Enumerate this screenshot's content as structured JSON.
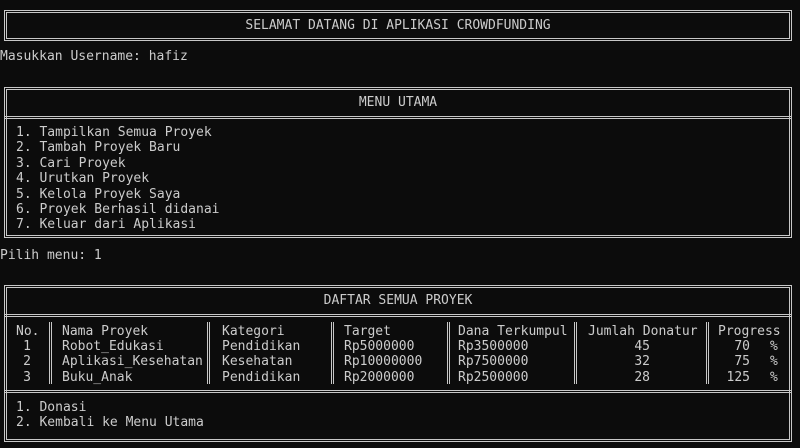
{
  "welcome_banner": "SELAMAT DATANG DI APLIKASI CROWDFUNDING",
  "username_prompt": "Masukkan Username: hafiz",
  "main_menu": {
    "title": "MENU UTAMA",
    "items": [
      "1. Tampilkan Semua Proyek",
      "2. Tambah Proyek Baru",
      "3. Cari Proyek",
      "4. Urutkan Proyek",
      "5. Kelola Proyek Saya",
      "6. Proyek Berhasil didanai",
      "7. Keluar dari Aplikasi"
    ]
  },
  "menu_prompt": "Pilih menu: 1",
  "project_list": {
    "title": "DAFTAR SEMUA PROYEK",
    "headers": {
      "no": "No.",
      "name": "Nama Proyek",
      "category": "Kategori",
      "target": "Target",
      "collected": "Dana Terkumpul",
      "donors": "Jumlah Donatur",
      "progress": "Progress"
    },
    "rows": [
      {
        "no": "1",
        "name": "Robot_Edukasi",
        "category": "Pendidikan",
        "target": "Rp5000000",
        "collected": "Rp3500000",
        "donors": "45",
        "progress": "70",
        "pct": "%"
      },
      {
        "no": "2",
        "name": "Aplikasi_Kesehatan",
        "category": "Kesehatan",
        "target": "Rp10000000",
        "collected": "Rp7500000",
        "donors": "32",
        "progress": "75",
        "pct": "%"
      },
      {
        "no": "3",
        "name": "Buku_Anak",
        "category": "Pendidikan",
        "target": "Rp2000000",
        "collected": "Rp2500000",
        "donors": "28",
        "progress": "125",
        "pct": "%"
      }
    ],
    "actions": [
      "1. Donasi",
      "2. Kembali ke Menu Utama"
    ]
  }
}
